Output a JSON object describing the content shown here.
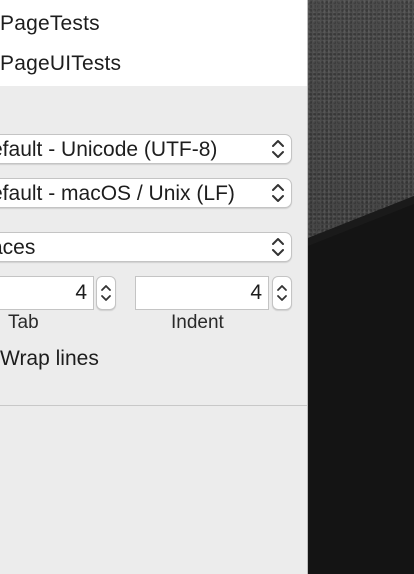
{
  "targets": [
    {
      "label": "PageTests"
    },
    {
      "label": "PageUITests"
    }
  ],
  "text_settings": {
    "encoding": "efault - Unicode (UTF-8)",
    "line_endings": "efault - macOS / Unix (LF)",
    "indent_using": "aces"
  },
  "widths": {
    "tab_value": "4",
    "tab_label": "Tab",
    "indent_value": "4",
    "indent_label": "Indent"
  },
  "wrap": {
    "label": "Wrap lines"
  }
}
